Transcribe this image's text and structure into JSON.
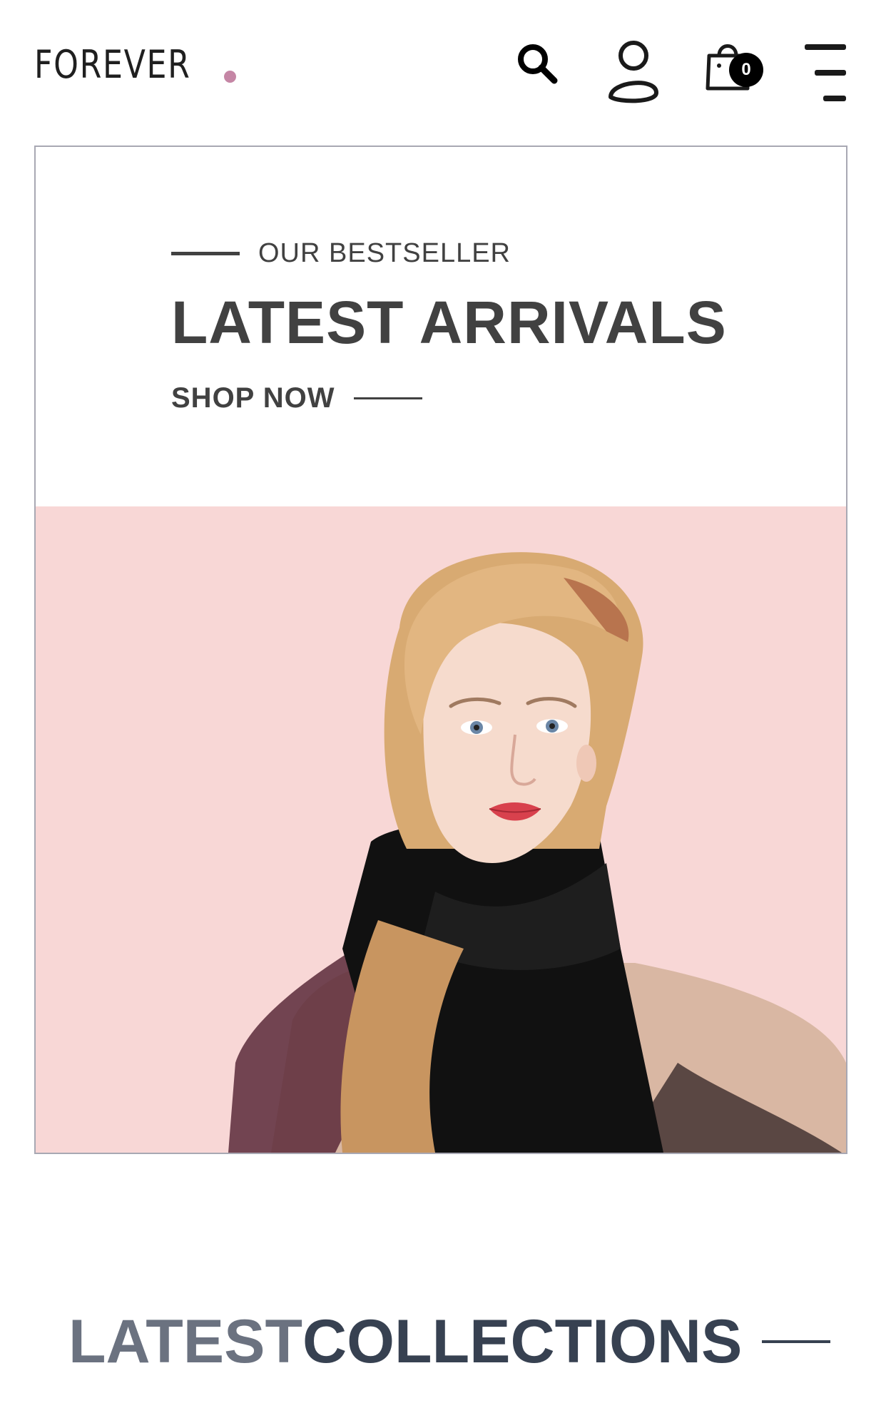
{
  "header": {
    "logo_text": "FOREVER",
    "logo_dot_color": "#c586a5",
    "icons": {
      "search": "search-icon",
      "profile": "profile-icon",
      "cart": "cart-icon",
      "menu": "menu-icon"
    },
    "cart_count": "0"
  },
  "hero": {
    "eyebrow": "OUR BESTSELLER",
    "title": "LATEST ARRIVALS",
    "cta": "SHOP NOW",
    "image_background_color": "#f8d7d6"
  },
  "collections": {
    "title_part1": "LATEST",
    "title_part2": "COLLECTIONS",
    "title_part1_color": "#6b7280",
    "title_part2_color": "#374151"
  }
}
